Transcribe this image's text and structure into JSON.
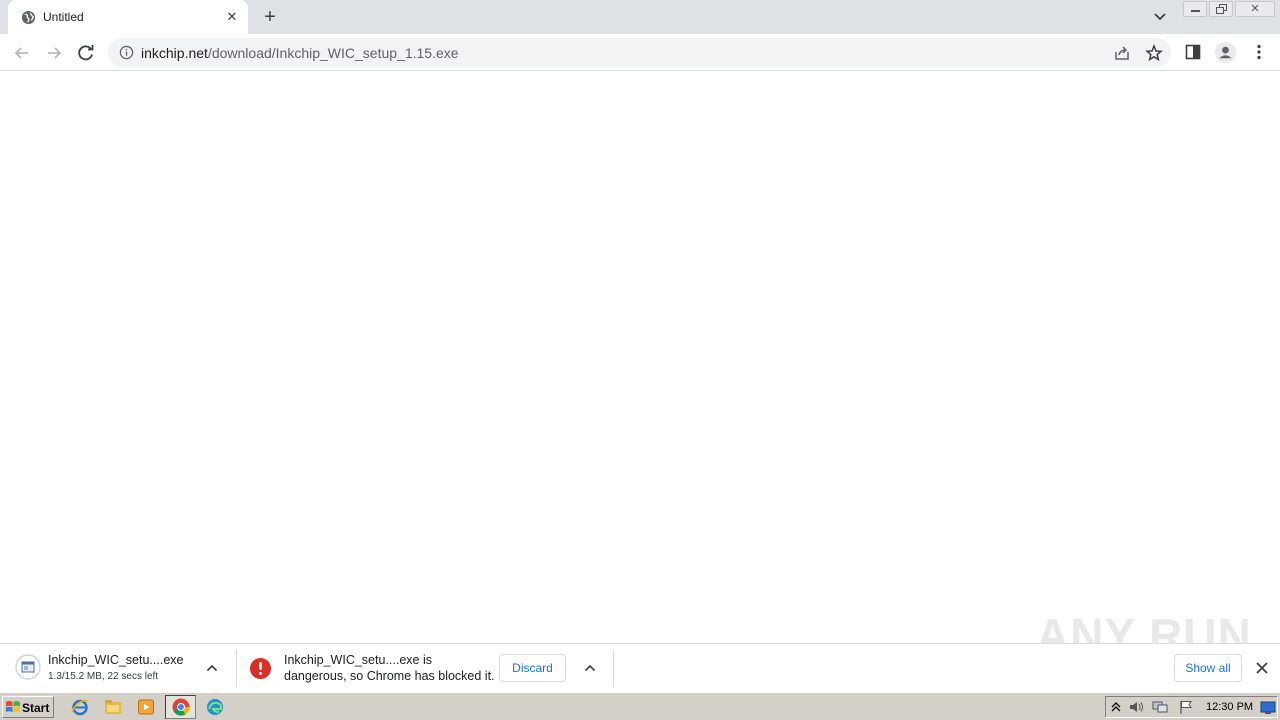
{
  "browser": {
    "tab": {
      "title": "Untitled"
    },
    "address": {
      "host": "inkchip.net",
      "path": "/download/Inkchip_WIC_setup_1.15.exe"
    }
  },
  "downloads": [
    {
      "name": "Inkchip_WIC_setu....exe",
      "status": "1.3/15.2 MB, 22 secs left"
    },
    {
      "line1": "Inkchip_WIC_setu....exe is",
      "line2": "dangerous, so Chrome has blocked it.",
      "discard_label": "Discard"
    }
  ],
  "shelf": {
    "show_all_label": "Show all"
  },
  "watermark": "ANY RUN",
  "taskbar": {
    "start_label": "Start",
    "clock": "12:30 PM"
  },
  "colors": {
    "tab_strip": "#dee1e6",
    "danger": "#d93025",
    "link_blue": "#1a73e8"
  }
}
